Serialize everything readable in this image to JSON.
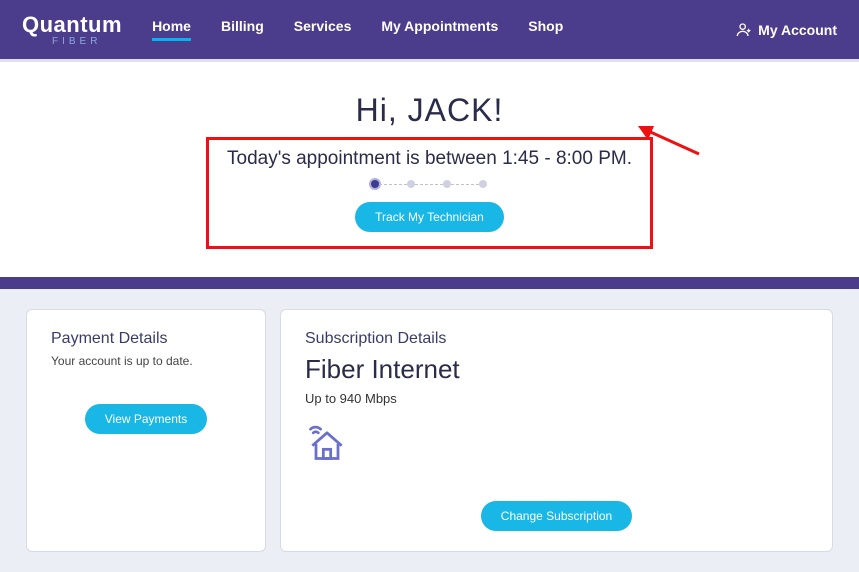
{
  "logo": {
    "main": "Quantum",
    "sub": "FIBER"
  },
  "nav": {
    "home": "Home",
    "billing": "Billing",
    "services": "Services",
    "appointments": "My Appointments",
    "shop": "Shop"
  },
  "account_label": "My Account",
  "greeting": "Hi, JACK!",
  "appointment_text": "Today's appointment is between 1:45 - 8:00 PM.",
  "track_button": "Track My Technician",
  "payment": {
    "title": "Payment Details",
    "status": "Your account is up to date.",
    "button": "View Payments"
  },
  "subscription": {
    "title": "Subscription Details",
    "plan": "Fiber Internet",
    "speed": "Up to 940 Mbps",
    "button": "Change Subscription"
  }
}
